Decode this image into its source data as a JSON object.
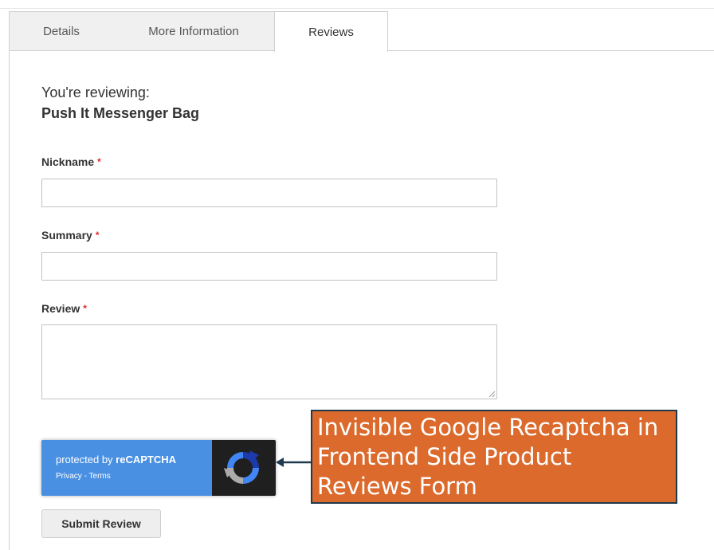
{
  "tabs": [
    {
      "label": "Details"
    },
    {
      "label": "More Information"
    },
    {
      "label": "Reviews"
    }
  ],
  "review_form": {
    "reviewing_label": "You're reviewing:",
    "product_name": "Push It Messenger Bag",
    "required_marker": "*",
    "nickname_label": "Nickname",
    "nickname_value": "",
    "summary_label": "Summary",
    "summary_value": "",
    "review_label": "Review",
    "review_value": "",
    "submit_label": "Submit Review"
  },
  "recaptcha": {
    "protected_by": "protected by ",
    "brand": "reCAPTCHA",
    "privacy": "Privacy",
    "separator": " - ",
    "terms": "Terms"
  },
  "annotation": {
    "text": "Invisible Google Recaptcha in Frontend Side Product Reviews Form"
  },
  "colors": {
    "recaptcha_blue": "#4a90e2",
    "recaptcha_dark": "#1f1f1f",
    "annotation_bg": "#db6a2c",
    "annotation_border": "#1f3a4d",
    "required_red": "#e02b27"
  }
}
